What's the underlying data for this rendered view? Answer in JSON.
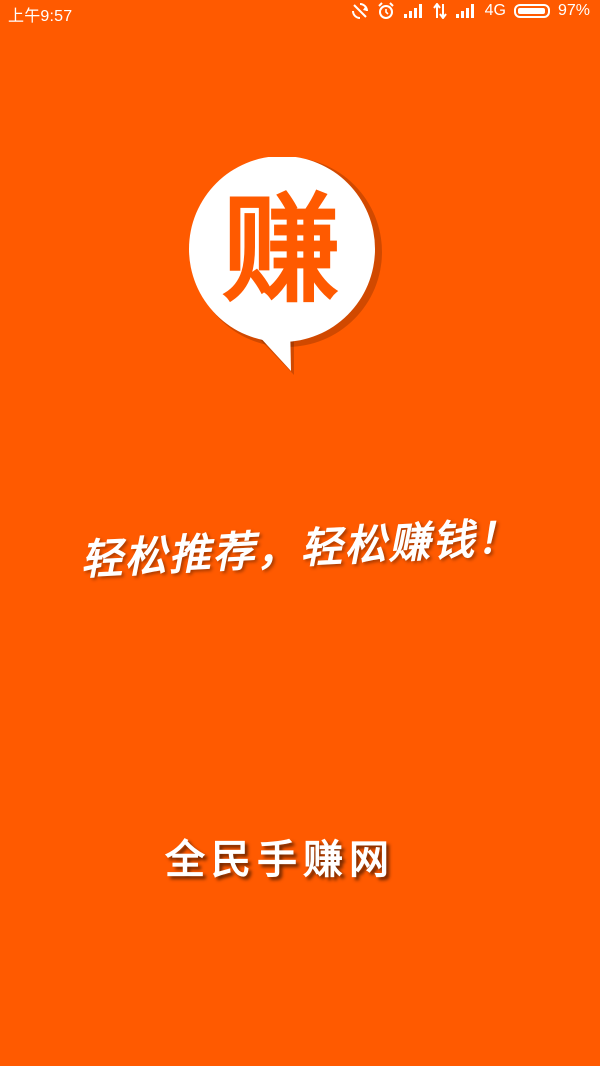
{
  "status_bar": {
    "time": "上午9:57",
    "network": "4G",
    "battery_percent_label": "97%",
    "battery_level": 0.97,
    "icons": [
      "sync-off-icon",
      "alarm-icon",
      "signal-icon",
      "data-arrows-icon",
      "signal-icon",
      "battery-icon"
    ]
  },
  "splash": {
    "logo_char": "赚",
    "slogan": "轻松推荐，轻松赚钱！",
    "brand_name": "全民手赚网"
  },
  "colors": {
    "background": "#FF5A00",
    "logo_bubble": "#FFFFFF",
    "logo_char": "#FF5A00",
    "text": "#FFFFFF"
  }
}
